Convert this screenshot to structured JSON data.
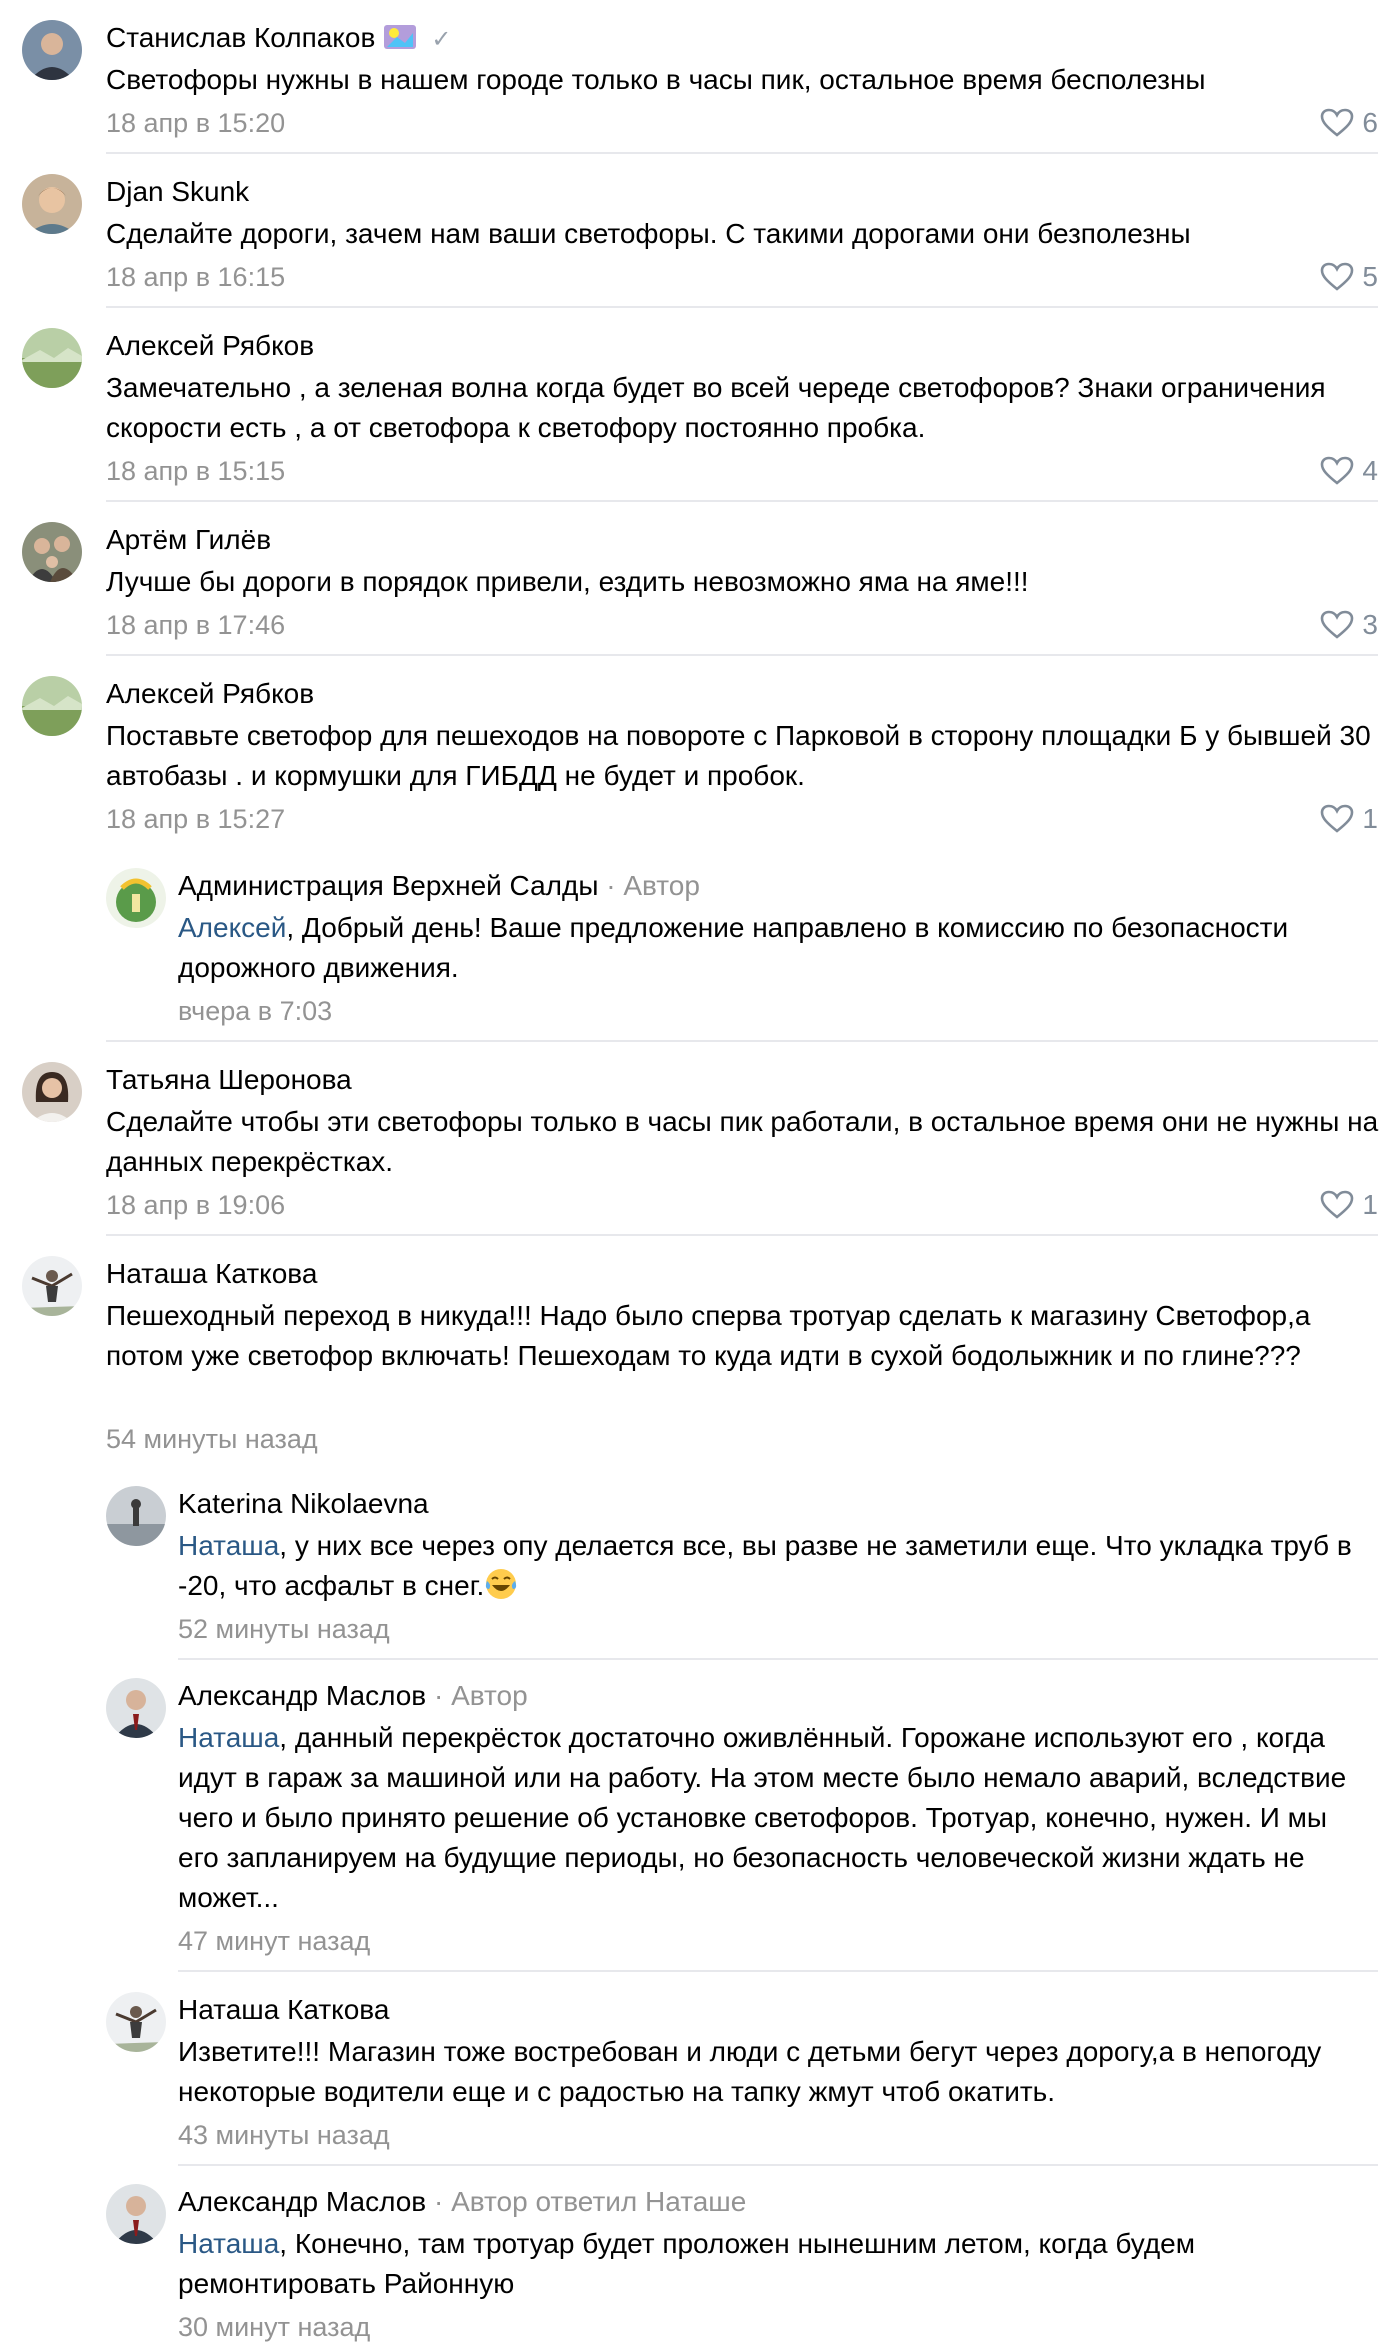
{
  "comments": [
    {
      "author": "Станислав Колпаков",
      "text": "Светофоры нужны в нашем городе только в часы пик, остальное время бесполезны",
      "date": "18 апр в 15:20",
      "likes": "6",
      "avatar_icon": "avatar-man-icon"
    },
    {
      "author": "Djan Skunk",
      "text": "Сделайте дороги, зачем нам ваши светофоры. С такими дорогами они безполезны",
      "date": "18 апр в 16:15",
      "likes": "5",
      "avatar_icon": "avatar-boy-icon"
    },
    {
      "author": "Алексей Рябков",
      "text": "Замечательно , а зеленая волна когда будет во всей череде светофоров? Знаки ограничения скорости есть , а от светофора к светофору постоянно пробка.",
      "date": "18 апр в 15:15",
      "likes": "4",
      "avatar_icon": "avatar-landscape-icon"
    },
    {
      "author": "Артём Гилёв",
      "text": "Лучше бы дороги в порядок привели, ездить невозможно яма на яме!!!",
      "date": "18 апр в 17:46",
      "likes": "3",
      "avatar_icon": "avatar-family-icon"
    },
    {
      "author": "Алексей Рябков",
      "text": "Поставьте светофор для пешеходов на повороте с Парковой в сторону площадки Б у бывшей 30 автобазы . и кормушки для ГИБДД не будет и пробок.",
      "date": "18 апр в 15:27",
      "likes": "1",
      "avatar_icon": "avatar-landscape-icon"
    },
    {
      "author": "Администрация Верхней Салды",
      "meta": " · Автор",
      "mention": "Алексей",
      "text": ", Добрый день! Ваше предложение направлено в комиссию по безопасности дорожного движения.",
      "date": "вчера в 7:03",
      "avatar_icon": "avatar-emblem-icon"
    },
    {
      "author": "Татьяна Шеронова",
      "text": "Сделайте чтобы эти светофоры только в часы пик работали, в остальное время они не нужны на данных перекрёстках.",
      "date": "18 апр в 19:06",
      "likes": "1",
      "avatar_icon": "avatar-woman-icon"
    },
    {
      "author": "Наташа Каткова",
      "text": "Пешеходный переход в никуда!!! Надо было сперва тротуар сделать к магазину Светофор,а потом уже светофор включать! Пешеходам то куда идти в сухой бодолыжник и по глине???",
      "date": "54 минуты назад",
      "avatar_icon": "avatar-person-icon"
    },
    {
      "author": "Katerina Nikolaevna",
      "mention": "Наташа",
      "text": ", у них все через опу делается все, вы разве не заметили еще. Что укладка труб в -20, что асфальт в снег.",
      "date": "52 минуты назад",
      "avatar_icon": "avatar-silhouette-icon",
      "emoji": "tears-of-joy-emoji"
    },
    {
      "author": "Александр Маслов",
      "meta": " · Автор",
      "mention": "Наташа",
      "text": ", данный перекрёсток достаточно оживлённый. Горожане используют его , когда идут в гараж за машиной или на работу. На этом месте было немало аварий, вследствие чего и было принято решение об установке светофоров. Тротуар, конечно, нужен. И мы его запланируем на будущие периоды, но безопасность человеческой жизни ждать не может...",
      "date": "47 минут назад",
      "avatar_icon": "avatar-suit-icon"
    },
    {
      "author": "Наташа Каткова",
      "text": "Изветите!!! Магазин тоже востребован и люди с детьми бегут через дорогу,а в непогоду некоторые водители еще и с радостью на тапку жмут чтоб окатить.",
      "date": "43 минуты назад",
      "avatar_icon": "avatar-person-icon"
    },
    {
      "author": "Александр Маслов",
      "meta": " · Автор",
      "reply": "ответил Наташе",
      "mention": "Наташа",
      "text": ", Конечно, там тротуар будет проложен нынешним летом, когда будем ремонтировать Районную",
      "date": "30 минут назад",
      "avatar_icon": "avatar-suit-icon"
    }
  ],
  "colors": {
    "link": "#2a5885",
    "secondary": "#939393",
    "divider": "#e7e8ec",
    "icon": "#818c99"
  }
}
